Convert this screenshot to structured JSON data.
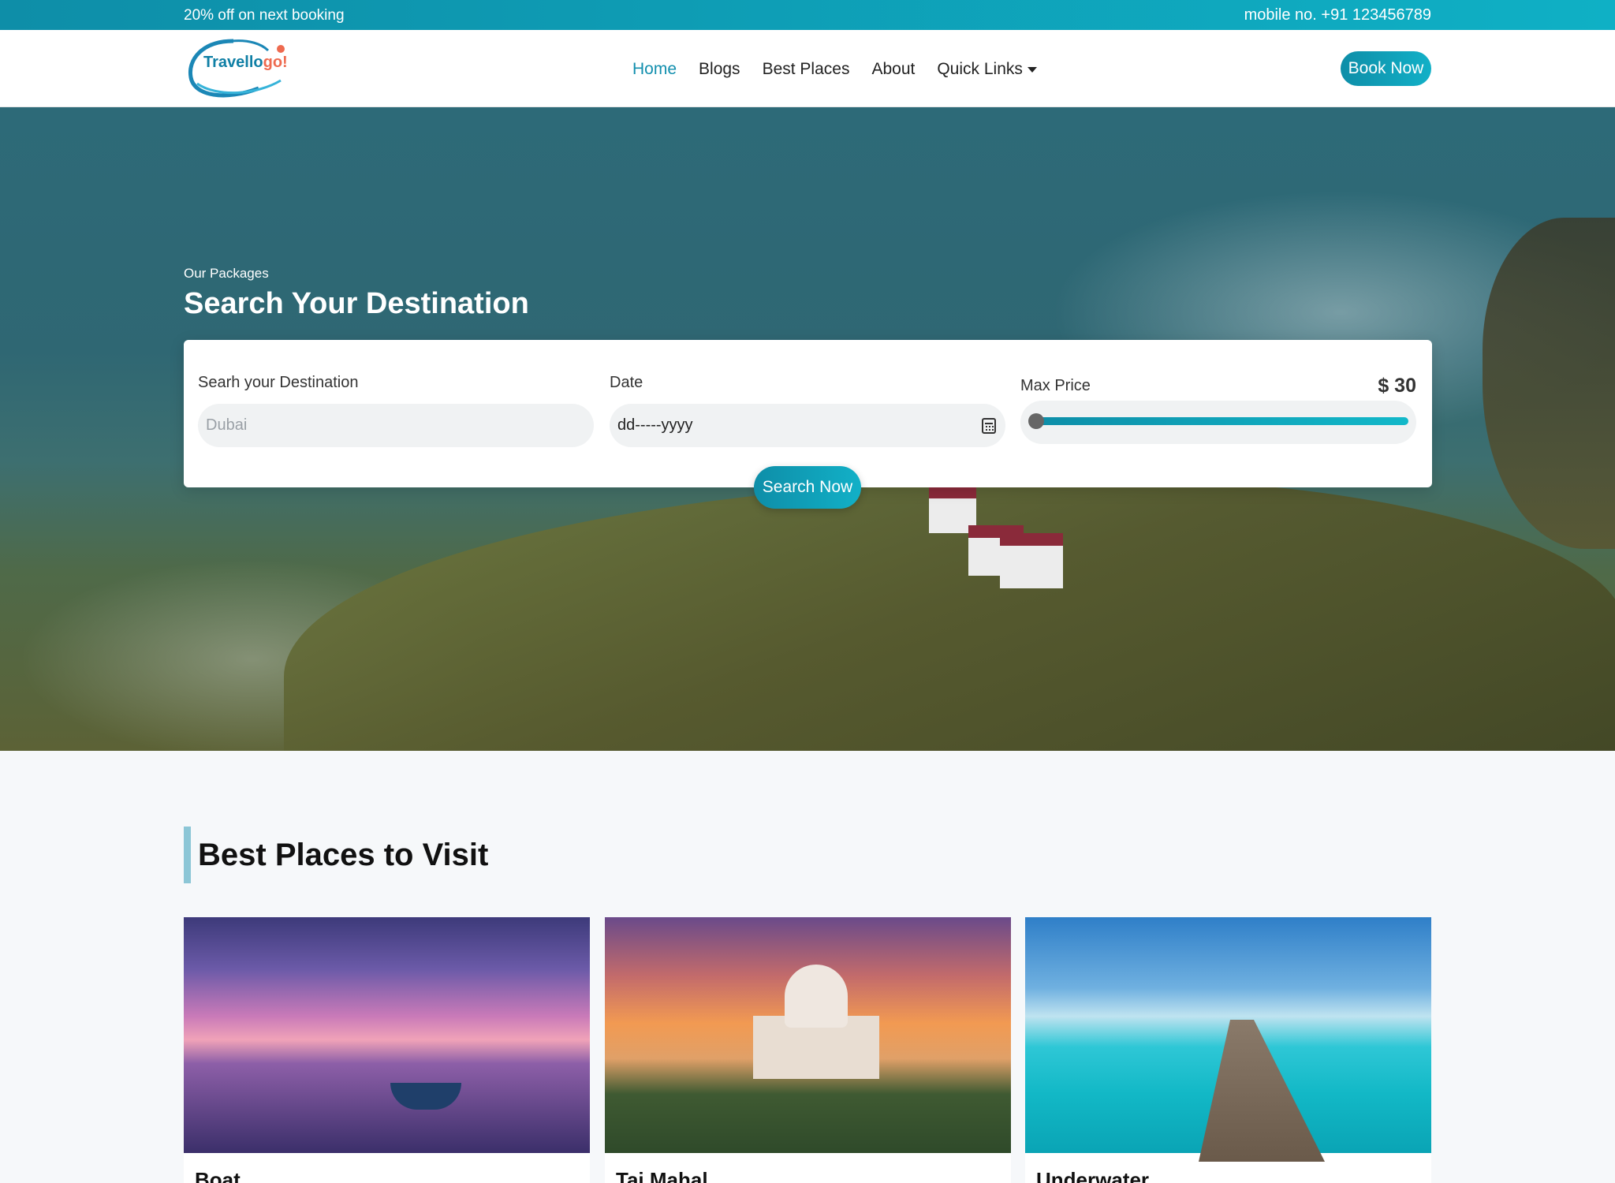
{
  "topbar": {
    "promo": "20% off on next booking",
    "phone": "mobile no. +91 123456789"
  },
  "brand": {
    "name_main": "Travello",
    "name_accent": "go!"
  },
  "nav": {
    "items": [
      {
        "label": "Home"
      },
      {
        "label": "Blogs"
      },
      {
        "label": "Best Places"
      },
      {
        "label": "About"
      },
      {
        "label": "Quick Links"
      }
    ],
    "cta": "Book Now"
  },
  "hero": {
    "subtitle": "Our Packages",
    "title": "Search Your Destination"
  },
  "search": {
    "destination_label": "Searh your Destination",
    "destination_placeholder": "Dubai",
    "date_label": "Date",
    "date_value": "dd-----yyyy",
    "price_label": "Max Price",
    "price_value": "$ 30",
    "price_level": 0,
    "button": "Search Now"
  },
  "places": {
    "title": "Best Places to Visit",
    "cards": [
      {
        "name": "Boat"
      },
      {
        "name": "Taj Mahal"
      },
      {
        "name": "Underwater"
      }
    ]
  },
  "colors": {
    "accent": "#0e8ea8",
    "accent_light": "#12b0c7",
    "logo_accent": "#ee6a4f"
  }
}
